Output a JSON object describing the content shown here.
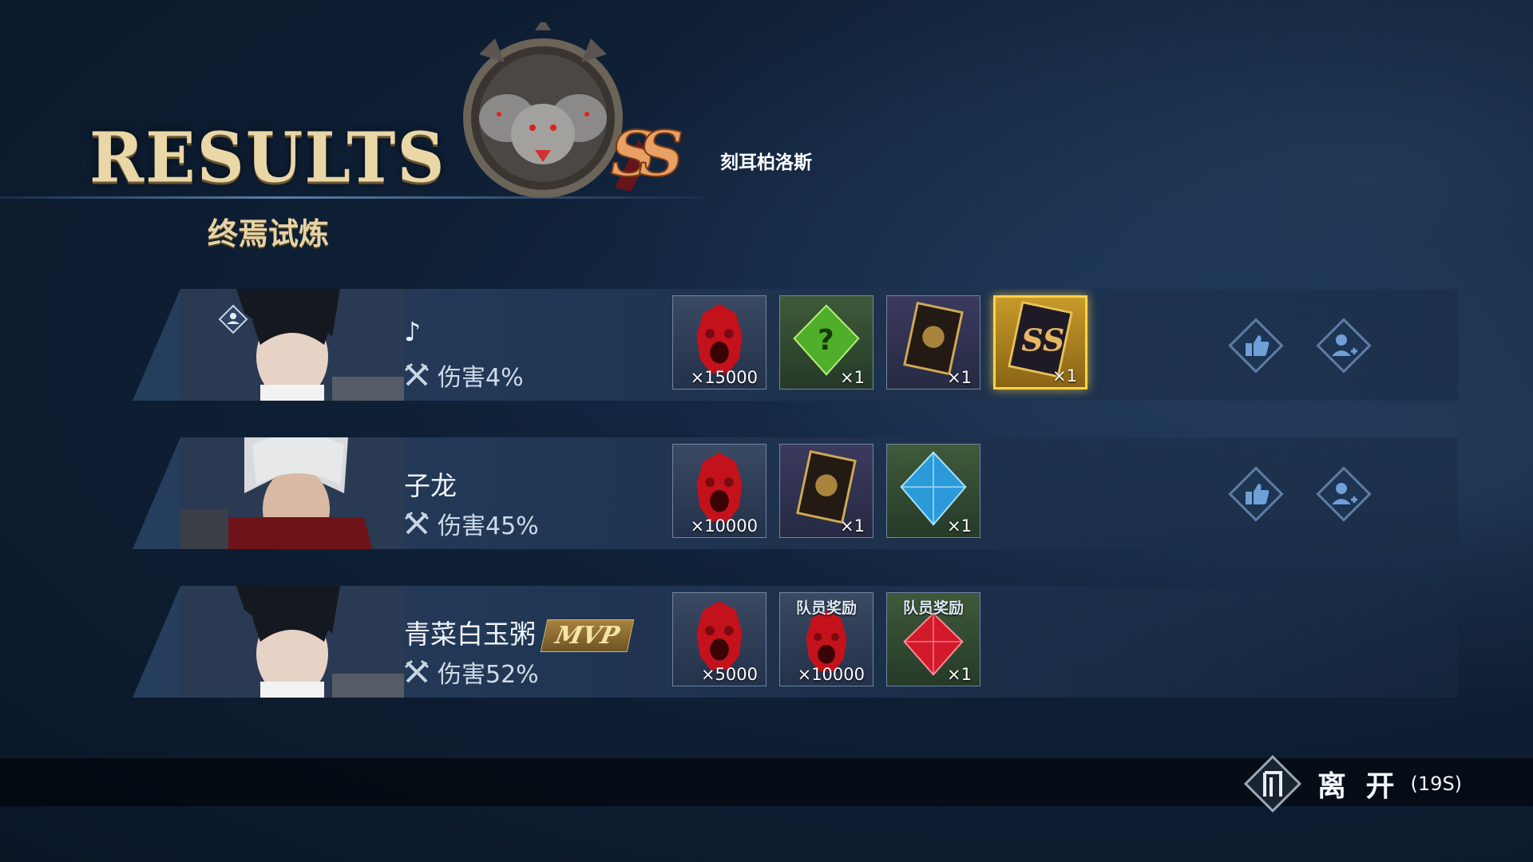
{
  "header": {
    "title": "RESULTS",
    "subtitle": "终焉试炼",
    "boss_name": "刻耳柏洛斯"
  },
  "players": [
    {
      "name": "♪",
      "damage": "伤害4%",
      "mvp": "",
      "rewards": [
        {
          "icon": "red-demon-mask",
          "qty": "×15000",
          "tag": ""
        },
        {
          "icon": "green-mystery-crystal",
          "qty": "×1",
          "tag": ""
        },
        {
          "icon": "ornate-card",
          "qty": "×1",
          "tag": ""
        },
        {
          "icon": "ss-gold-card",
          "qty": "×1",
          "tag": ""
        }
      ]
    },
    {
      "name": "子龙",
      "damage": "伤害45%",
      "mvp": "",
      "rewards": [
        {
          "icon": "red-demon-mask",
          "qty": "×10000",
          "tag": ""
        },
        {
          "icon": "ornate-card",
          "qty": "×1",
          "tag": ""
        },
        {
          "icon": "blue-crystal",
          "qty": "×1",
          "tag": ""
        }
      ]
    },
    {
      "name": "青菜白玉粥",
      "damage": "伤害52%",
      "mvp": "MVP",
      "rewards": [
        {
          "icon": "red-demon-mask",
          "qty": "×5000",
          "tag": ""
        },
        {
          "icon": "red-demon-mask",
          "qty": "×10000",
          "tag": "队员奖励"
        },
        {
          "icon": "red-crystal",
          "qty": "×1",
          "tag": "队员奖励"
        }
      ]
    }
  ],
  "footer": {
    "leave_label": "离 开",
    "timer": "(19S)"
  },
  "colors": {
    "gold": "#ffd24a",
    "title": "#e9d7a8"
  }
}
